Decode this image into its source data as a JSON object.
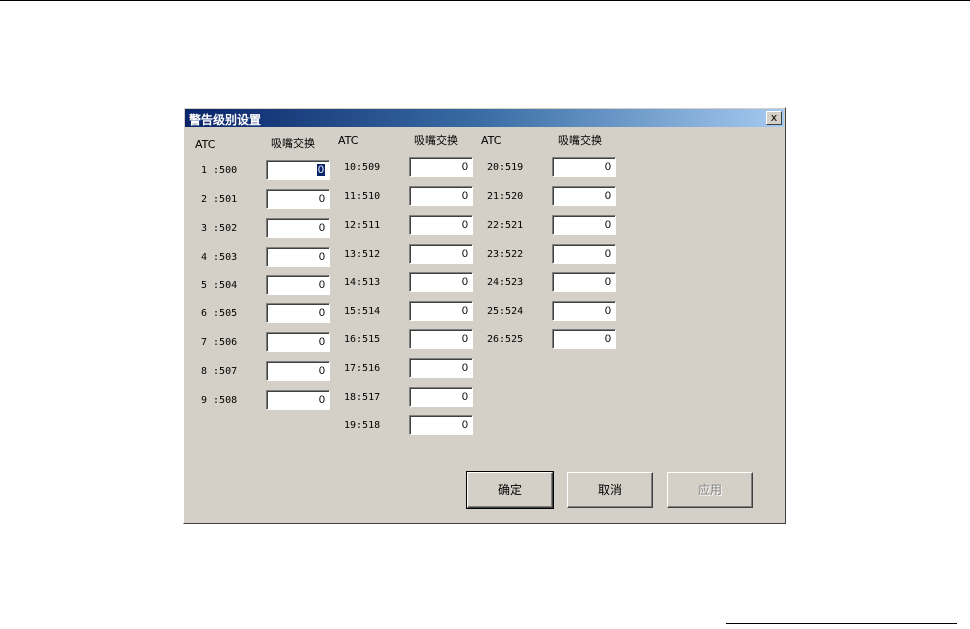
{
  "dialog": {
    "title": "警告级别设置",
    "close_glyph": "x"
  },
  "columns": [
    {
      "atc_header": "ATC",
      "value_header": "吸嘴交换",
      "rows": [
        {
          "label": "1 :500",
          "value": "0"
        },
        {
          "label": "2 :501",
          "value": "0"
        },
        {
          "label": "3 :502",
          "value": "0"
        },
        {
          "label": "4 :503",
          "value": "0"
        },
        {
          "label": "5 :504",
          "value": "0"
        },
        {
          "label": "6 :505",
          "value": "0"
        },
        {
          "label": "7 :506",
          "value": "0"
        },
        {
          "label": "8 :507",
          "value": "0"
        },
        {
          "label": "9 :508",
          "value": "0"
        }
      ]
    },
    {
      "atc_header": "ATC",
      "value_header": "吸嘴交换",
      "rows": [
        {
          "label": "10:509",
          "value": "0"
        },
        {
          "label": "11:510",
          "value": "0"
        },
        {
          "label": "12:511",
          "value": "0"
        },
        {
          "label": "13:512",
          "value": "0"
        },
        {
          "label": "14:513",
          "value": "0"
        },
        {
          "label": "15:514",
          "value": "0"
        },
        {
          "label": "16:515",
          "value": "0"
        },
        {
          "label": "17:516",
          "value": "0"
        },
        {
          "label": "18:517",
          "value": "0"
        },
        {
          "label": "19:518",
          "value": "0"
        }
      ]
    },
    {
      "atc_header": "ATC",
      "value_header": "吸嘴交换",
      "rows": [
        {
          "label": "20:519",
          "value": "0"
        },
        {
          "label": "21:520",
          "value": "0"
        },
        {
          "label": "22:521",
          "value": "0"
        },
        {
          "label": "23:522",
          "value": "0"
        },
        {
          "label": "24:523",
          "value": "0"
        },
        {
          "label": "25:524",
          "value": "0"
        },
        {
          "label": "26:525",
          "value": "0"
        }
      ]
    }
  ],
  "buttons": {
    "ok": "确定",
    "cancel": "取消",
    "apply": "应用"
  }
}
